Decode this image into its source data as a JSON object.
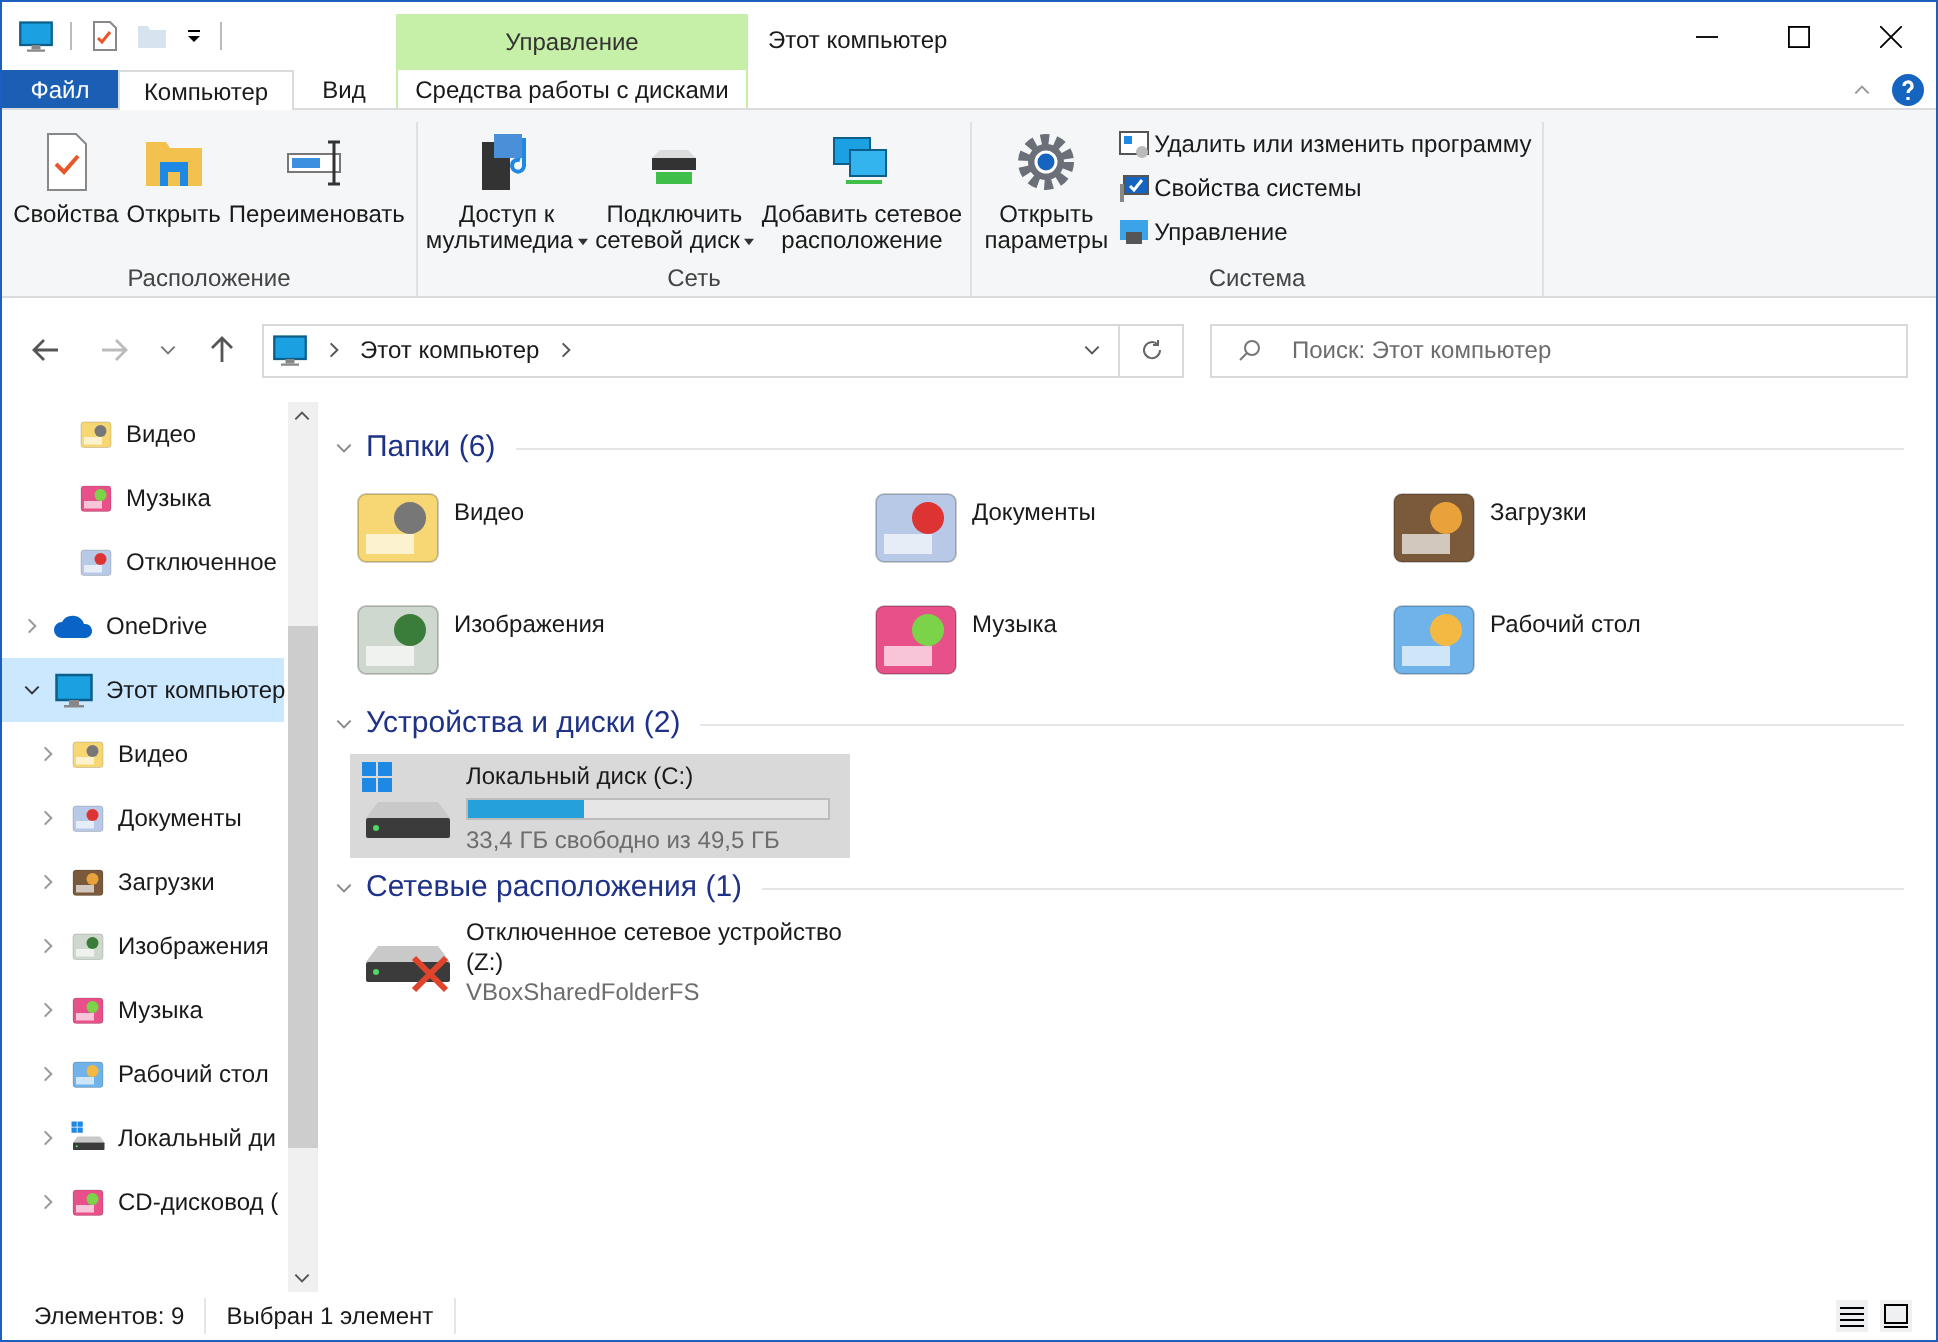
{
  "window": {
    "title": "Этот компьютер",
    "context_group": "Управление"
  },
  "ribbon_tabs": [
    {
      "label": "Файл",
      "kind": "file",
      "selected": false
    },
    {
      "label": "Компьютер",
      "kind": "tab",
      "selected": true
    },
    {
      "label": "Вид",
      "kind": "tab",
      "selected": false
    },
    {
      "label": "Средства работы с дисками",
      "kind": "context",
      "selected": false
    }
  ],
  "ribbon_groups": [
    {
      "label": "Расположение",
      "buttons": [
        {
          "lines": [
            "Свойства"
          ],
          "dropdown": false
        },
        {
          "lines": [
            "Открыть"
          ],
          "dropdown": false
        },
        {
          "lines": [
            "Переименовать"
          ],
          "dropdown": false
        }
      ]
    },
    {
      "label": "Сеть",
      "buttons": [
        {
          "lines": [
            "Доступ к",
            "мультимедиа"
          ],
          "dropdown": true
        },
        {
          "lines": [
            "Подключить",
            "сетевой диск"
          ],
          "dropdown": true
        },
        {
          "lines": [
            "Добавить сетевое",
            "расположение"
          ],
          "dropdown": false
        }
      ]
    },
    {
      "label": "Система",
      "buttons": [
        {
          "lines": [
            "Открыть",
            "параметры"
          ],
          "dropdown": false
        }
      ],
      "small_buttons": [
        "Удалить или изменить программу",
        "Свойства системы",
        "Управление"
      ]
    }
  ],
  "address": {
    "path": "Этот компьютер"
  },
  "search": {
    "placeholder": "Поиск: Этот компьютер"
  },
  "quick_access_items": [
    "Видео",
    "Музыка",
    "Отключенное"
  ],
  "tree": [
    {
      "label": "OneDrive",
      "expanded": false,
      "selected": false
    },
    {
      "label": "Этот компьютер",
      "expanded": true,
      "selected": true,
      "children": [
        {
          "label": "Видео",
          "expanded": false,
          "selected": false
        },
        {
          "label": "Документы",
          "expanded": false,
          "selected": false
        },
        {
          "label": "Загрузки",
          "expanded": false,
          "selected": false
        },
        {
          "label": "Изображения",
          "expanded": false,
          "selected": false
        },
        {
          "label": "Музыка",
          "expanded": false,
          "selected": false
        },
        {
          "label": "Рабочий стол",
          "expanded": false,
          "selected": false
        },
        {
          "label": "Локальный ди",
          "expanded": false,
          "selected": false
        },
        {
          "label": "CD-дисковод (",
          "expanded": false,
          "selected": false
        }
      ]
    }
  ],
  "sections": [
    {
      "title": "Папки (6)",
      "kind": "folders",
      "expanded": true,
      "items": [
        {
          "name": "Видео"
        },
        {
          "name": "Документы"
        },
        {
          "name": "Загрузки"
        },
        {
          "name": "Изображения"
        },
        {
          "name": "Музыка"
        },
        {
          "name": "Рабочий стол"
        }
      ]
    },
    {
      "title": "Устройства и диски (2)",
      "kind": "drives",
      "expanded": true,
      "items": [
        {
          "name": "Локальный диск (C:)",
          "level": 0.32,
          "free": "33,4 ГБ свободно из 49,5 ГБ",
          "selected": true
        }
      ]
    },
    {
      "title": "Сетевые расположения (1)",
      "kind": "network",
      "expanded": true,
      "items": [
        {
          "name": "Отключенное сетевое устройство (Z:)",
          "sub": "VBoxSharedFolderFS"
        }
      ]
    }
  ],
  "status_bar": [
    "Элементов: 9",
    "Выбран 1 элемент"
  ]
}
